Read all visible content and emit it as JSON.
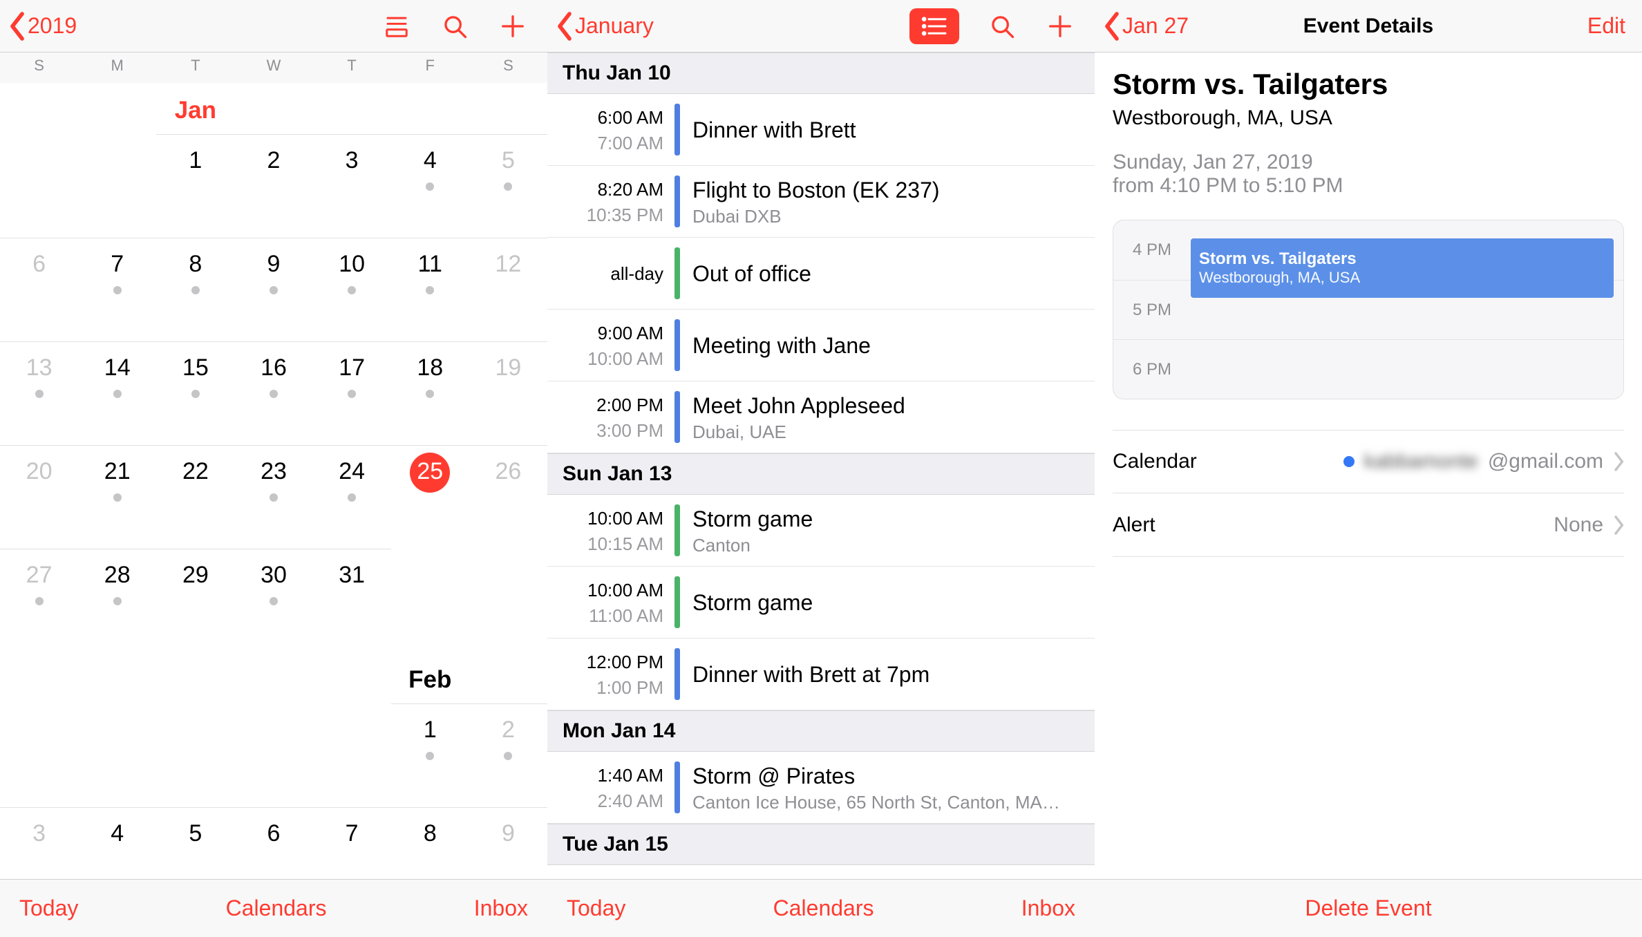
{
  "panel1": {
    "back_label": "2019",
    "weekdays": [
      "S",
      "M",
      "T",
      "W",
      "T",
      "F",
      "S"
    ],
    "month1_label": "Jan",
    "month2_label": "Feb",
    "today": 25,
    "toolbar": {
      "left": "Today",
      "center": "Calendars",
      "right": "Inbox"
    }
  },
  "month1_cells": [
    {
      "d": "",
      "dot": false,
      "out": false,
      "blank": true
    },
    {
      "d": "",
      "dot": false,
      "out": false,
      "blank": true
    },
    {
      "d": "1",
      "dot": false,
      "out": false
    },
    {
      "d": "2",
      "dot": false,
      "out": false
    },
    {
      "d": "3",
      "dot": false,
      "out": false
    },
    {
      "d": "4",
      "dot": true,
      "out": false
    },
    {
      "d": "5",
      "dot": true,
      "out": true
    },
    {
      "d": "6",
      "dot": false,
      "out": true
    },
    {
      "d": "7",
      "dot": true,
      "out": false
    },
    {
      "d": "8",
      "dot": true,
      "out": false
    },
    {
      "d": "9",
      "dot": true,
      "out": false
    },
    {
      "d": "10",
      "dot": true,
      "out": false
    },
    {
      "d": "11",
      "dot": true,
      "out": false
    },
    {
      "d": "12",
      "dot": false,
      "out": true
    },
    {
      "d": "13",
      "dot": true,
      "out": true
    },
    {
      "d": "14",
      "dot": true,
      "out": false
    },
    {
      "d": "15",
      "dot": true,
      "out": false
    },
    {
      "d": "16",
      "dot": true,
      "out": false
    },
    {
      "d": "17",
      "dot": true,
      "out": false
    },
    {
      "d": "18",
      "dot": true,
      "out": false
    },
    {
      "d": "19",
      "dot": false,
      "out": true
    },
    {
      "d": "20",
      "dot": false,
      "out": true
    },
    {
      "d": "21",
      "dot": true,
      "out": false
    },
    {
      "d": "22",
      "dot": false,
      "out": false
    },
    {
      "d": "23",
      "dot": true,
      "out": false
    },
    {
      "d": "24",
      "dot": true,
      "out": false
    },
    {
      "d": "25",
      "dot": false,
      "out": false
    },
    {
      "d": "26",
      "dot": false,
      "out": true
    },
    {
      "d": "27",
      "dot": true,
      "out": true
    },
    {
      "d": "28",
      "dot": true,
      "out": false
    },
    {
      "d": "29",
      "dot": false,
      "out": false
    },
    {
      "d": "30",
      "dot": true,
      "out": false
    },
    {
      "d": "31",
      "dot": false,
      "out": false
    },
    {
      "d": "",
      "dot": false,
      "out": false,
      "blank": true
    },
    {
      "d": "",
      "dot": false,
      "out": false,
      "blank": true
    }
  ],
  "month2_cells": [
    {
      "d": "",
      "dot": false,
      "out": false,
      "blank": true
    },
    {
      "d": "",
      "dot": false,
      "out": false,
      "blank": true
    },
    {
      "d": "",
      "dot": false,
      "out": false,
      "blank": true
    },
    {
      "d": "",
      "dot": false,
      "out": false,
      "blank": true
    },
    {
      "d": "",
      "dot": false,
      "out": false,
      "blank": true
    },
    {
      "d": "1",
      "dot": true,
      "out": false
    },
    {
      "d": "2",
      "dot": true,
      "out": true
    },
    {
      "d": "3",
      "dot": false,
      "out": true
    },
    {
      "d": "4",
      "dot": false,
      "out": false
    },
    {
      "d": "5",
      "dot": false,
      "out": false
    },
    {
      "d": "6",
      "dot": false,
      "out": false
    },
    {
      "d": "7",
      "dot": false,
      "out": false
    },
    {
      "d": "8",
      "dot": false,
      "out": false
    },
    {
      "d": "9",
      "dot": false,
      "out": true
    }
  ],
  "panel2": {
    "back_label": "January",
    "toolbar": {
      "left": "Today",
      "center": "Calendars",
      "right": "Inbox"
    },
    "days": [
      {
        "header": "Thu  Jan 10",
        "events": [
          {
            "t1": "6:00 AM",
            "t2": "7:00 AM",
            "color": "blue",
            "title": "Dinner with Brett",
            "loc": ""
          },
          {
            "t1": "8:20 AM",
            "t2": "10:35 PM",
            "color": "blue",
            "title": "Flight to Boston (EK 237)",
            "loc": "Dubai DXB"
          },
          {
            "t1": "all-day",
            "t2": "",
            "color": "green",
            "title": "Out of office",
            "loc": ""
          },
          {
            "t1": "9:00 AM",
            "t2": "10:00 AM",
            "color": "blue",
            "title": "Meeting with Jane",
            "loc": ""
          },
          {
            "t1": "2:00 PM",
            "t2": "3:00 PM",
            "color": "blue",
            "title": "Meet John Appleseed",
            "loc": "Dubai, UAE"
          }
        ]
      },
      {
        "header": "Sun  Jan 13",
        "events": [
          {
            "t1": "10:00 AM",
            "t2": "10:15 AM",
            "color": "green",
            "title": "Storm game",
            "loc": "Canton"
          },
          {
            "t1": "10:00 AM",
            "t2": "11:00 AM",
            "color": "green",
            "title": "Storm game",
            "loc": ""
          },
          {
            "t1": "12:00 PM",
            "t2": "1:00 PM",
            "color": "blue",
            "title": "Dinner with Brett at 7pm",
            "loc": ""
          }
        ]
      },
      {
        "header": "Mon  Jan 14",
        "events": [
          {
            "t1": "1:40 AM",
            "t2": "2:40 AM",
            "color": "blue",
            "title": "Storm @ Pirates",
            "loc": "Canton Ice House, 65 North St, Canton, MA…"
          }
        ]
      },
      {
        "header": "Tue  Jan 15",
        "events": []
      }
    ]
  },
  "panel3": {
    "back_label": "Jan 27",
    "nav_title": "Event Details",
    "edit_label": "Edit",
    "event_title": "Storm vs. Tailgaters",
    "event_location": "Westborough, MA, USA",
    "event_date": "Sunday, Jan 27, 2019",
    "event_time": "from 4:10 PM to 5:10 PM",
    "sched_labels": [
      "4 PM",
      "5 PM",
      "6 PM"
    ],
    "sched_event_title": "Storm vs. Tailgaters",
    "sched_event_loc": "Westborough, MA, USA",
    "rows": {
      "calendar_label": "Calendar",
      "calendar_value_hidden": "kabbamonte",
      "calendar_value_suffix": "@gmail.com",
      "alert_label": "Alert",
      "alert_value": "None"
    },
    "delete_label": "Delete Event"
  }
}
